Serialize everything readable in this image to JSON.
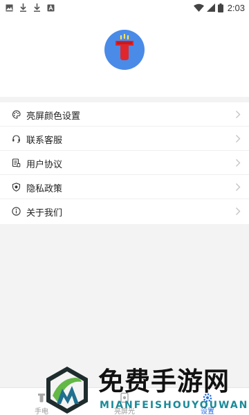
{
  "status_bar": {
    "time": "2:03",
    "left_icons": [
      "image-icon",
      "download-icon",
      "download-icon",
      "app-icon"
    ],
    "right_icons": [
      "wifi-icon",
      "signal-icon",
      "battery-icon"
    ]
  },
  "header": {
    "logo_icon": "flashlight-icon",
    "logo_color": "#4a8be8"
  },
  "menu": {
    "items": [
      {
        "label": "亮屏颜色设置",
        "icon": "palette-icon"
      },
      {
        "label": "联系客服",
        "icon": "headset-icon"
      },
      {
        "label": "用户协议",
        "icon": "document-icon"
      },
      {
        "label": "隐私政策",
        "icon": "shield-icon"
      },
      {
        "label": "关于我们",
        "icon": "info-icon"
      }
    ]
  },
  "tabbar": {
    "tabs": [
      {
        "label": "手电",
        "icon": "flashlight-icon",
        "active": false
      },
      {
        "label": "亮屏光",
        "icon": "screen-light-icon",
        "active": false
      },
      {
        "label": "设置",
        "icon": "settings-icon",
        "active": true
      }
    ],
    "active_color": "#2c6fe0"
  },
  "watermark": {
    "title": "免费手游网",
    "subtitle": "MIANFEISHOUYOUWANG"
  }
}
